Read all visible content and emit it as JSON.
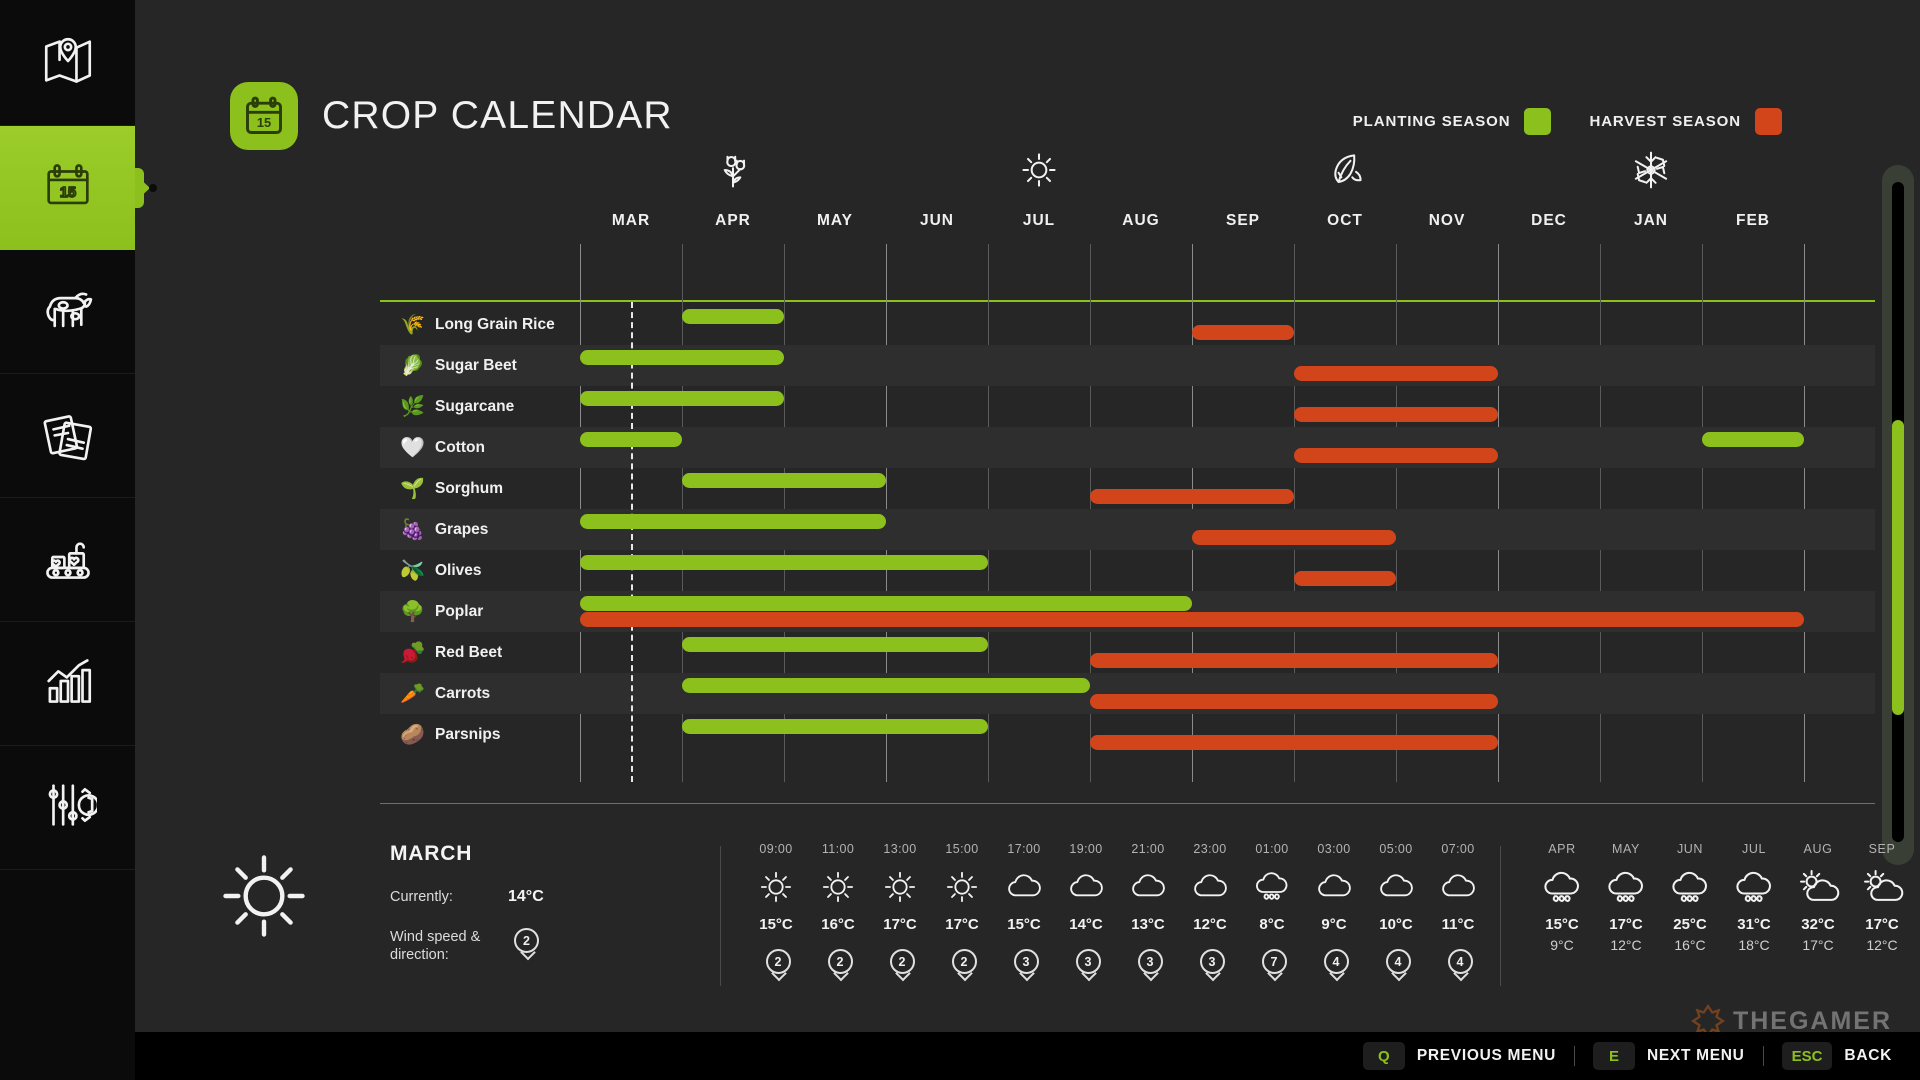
{
  "header": {
    "title": "CROP CALENDAR",
    "calendar_icon_day": "15"
  },
  "legend": {
    "planting_label": "PLANTING SEASON",
    "planting_color": "#8cc01c",
    "harvest_label": "HARVEST SEASON",
    "harvest_color": "#d2451b"
  },
  "sidebar": {
    "items": [
      {
        "name": "map",
        "icon": "map-icon",
        "active": false
      },
      {
        "name": "calendar",
        "icon": "calendar-icon",
        "active": true
      },
      {
        "name": "animals",
        "icon": "cow-icon",
        "active": false
      },
      {
        "name": "contracts",
        "icon": "documents-icon",
        "active": false
      },
      {
        "name": "production",
        "icon": "conveyor-icon",
        "active": false
      },
      {
        "name": "statistics",
        "icon": "bar-chart-icon",
        "active": false
      },
      {
        "name": "settings",
        "icon": "sliders-gear-icon",
        "active": false
      }
    ]
  },
  "chart_data": {
    "type": "table",
    "title": "CROP CALENDAR",
    "months": [
      "MAR",
      "APR",
      "MAY",
      "JUN",
      "JUL",
      "AUG",
      "SEP",
      "OCT",
      "NOV",
      "DEC",
      "JAN",
      "FEB"
    ],
    "season_markers": [
      {
        "month": "APR",
        "icon": "flower-icon",
        "season": "spring"
      },
      {
        "month": "JUL",
        "icon": "sun-icon",
        "season": "summer"
      },
      {
        "month": "OCT",
        "icon": "leaf-icon",
        "season": "autumn"
      },
      {
        "month": "JAN",
        "icon": "snowflake-icon",
        "season": "winter"
      }
    ],
    "current_month_marker": "MAR",
    "rows": [
      {
        "crop": "Long Grain Rice",
        "icon": "🌾",
        "planting": [
          {
            "start": 1,
            "end": 2
          }
        ],
        "harvest": [
          {
            "start": 6,
            "end": 7
          }
        ]
      },
      {
        "crop": "Sugar Beet",
        "icon": "🥬",
        "planting": [
          {
            "start": 0,
            "end": 2
          }
        ],
        "harvest": [
          {
            "start": 7,
            "end": 9
          }
        ]
      },
      {
        "crop": "Sugarcane",
        "icon": "🌿",
        "planting": [
          {
            "start": 0,
            "end": 2
          }
        ],
        "harvest": [
          {
            "start": 7,
            "end": 9
          }
        ]
      },
      {
        "crop": "Cotton",
        "icon": "🤍",
        "planting": [
          {
            "start": 0,
            "end": 1
          },
          {
            "start": 11,
            "end": 12
          }
        ],
        "harvest": [
          {
            "start": 7,
            "end": 9
          }
        ]
      },
      {
        "crop": "Sorghum",
        "icon": "🌱",
        "planting": [
          {
            "start": 1,
            "end": 3
          }
        ],
        "harvest": [
          {
            "start": 5,
            "end": 7
          }
        ]
      },
      {
        "crop": "Grapes",
        "icon": "🍇",
        "planting": [
          {
            "start": 0,
            "end": 3
          }
        ],
        "harvest": [
          {
            "start": 6,
            "end": 8
          }
        ]
      },
      {
        "crop": "Olives",
        "icon": "🫒",
        "planting": [
          {
            "start": 0,
            "end": 4
          }
        ],
        "harvest": [
          {
            "start": 7,
            "end": 8
          }
        ]
      },
      {
        "crop": "Poplar",
        "icon": "🌳",
        "planting": [
          {
            "start": 0,
            "end": 6
          }
        ],
        "harvest": [
          {
            "start": 0,
            "end": 12
          }
        ]
      },
      {
        "crop": "Red Beet",
        "icon": "🫜",
        "planting": [
          {
            "start": 1,
            "end": 4
          }
        ],
        "harvest": [
          {
            "start": 5,
            "end": 9
          }
        ]
      },
      {
        "crop": "Carrots",
        "icon": "🥕",
        "planting": [
          {
            "start": 1,
            "end": 5
          }
        ],
        "harvest": [
          {
            "start": 5,
            "end": 9
          }
        ]
      },
      {
        "crop": "Parsnips",
        "icon": "🥔",
        "planting": [
          {
            "start": 1,
            "end": 4
          }
        ],
        "harvest": [
          {
            "start": 5,
            "end": 9
          }
        ]
      }
    ]
  },
  "weather": {
    "current_icon": "sun-icon",
    "month": "MARCH",
    "currently_label": "Currently:",
    "currently_value": "14°C",
    "wind_label": "Wind speed &\ndirection:",
    "wind_value": "2",
    "hourly": [
      {
        "time": "09:00",
        "icon": "sun-icon",
        "temp": "15°C",
        "wind": "2"
      },
      {
        "time": "11:00",
        "icon": "sun-icon",
        "temp": "16°C",
        "wind": "2"
      },
      {
        "time": "13:00",
        "icon": "sun-icon",
        "temp": "17°C",
        "wind": "2"
      },
      {
        "time": "15:00",
        "icon": "sun-icon",
        "temp": "17°C",
        "wind": "2"
      },
      {
        "time": "17:00",
        "icon": "cloud-icon",
        "temp": "15°C",
        "wind": "3"
      },
      {
        "time": "19:00",
        "icon": "cloud-icon",
        "temp": "14°C",
        "wind": "3"
      },
      {
        "time": "21:00",
        "icon": "cloud-icon",
        "temp": "13°C",
        "wind": "3"
      },
      {
        "time": "23:00",
        "icon": "cloud-icon",
        "temp": "12°C",
        "wind": "3"
      },
      {
        "time": "01:00",
        "icon": "rain-icon",
        "temp": "8°C",
        "wind": "7"
      },
      {
        "time": "03:00",
        "icon": "cloud-icon",
        "temp": "9°C",
        "wind": "4"
      },
      {
        "time": "05:00",
        "icon": "cloud-icon",
        "temp": "10°C",
        "wind": "4"
      },
      {
        "time": "07:00",
        "icon": "cloud-icon",
        "temp": "11°C",
        "wind": "4"
      }
    ],
    "monthly": [
      {
        "month": "APR",
        "icon": "rain-icon",
        "high": "15°C",
        "low": "9°C"
      },
      {
        "month": "MAY",
        "icon": "rain-icon",
        "high": "17°C",
        "low": "12°C"
      },
      {
        "month": "JUN",
        "icon": "rain-icon",
        "high": "25°C",
        "low": "16°C"
      },
      {
        "month": "JUL",
        "icon": "rain-icon",
        "high": "31°C",
        "low": "18°C"
      },
      {
        "month": "AUG",
        "icon": "partly-sunny-icon",
        "high": "32°C",
        "low": "17°C"
      },
      {
        "month": "SEP",
        "icon": "partly-sunny-icon",
        "high": "17°C",
        "low": "12°C"
      }
    ]
  },
  "footer": {
    "actions": [
      {
        "key": "Q",
        "label": "PREVIOUS MENU"
      },
      {
        "key": "E",
        "label": "NEXT MENU"
      },
      {
        "key": "ESC",
        "label": "BACK"
      }
    ],
    "watermark": "THEGAMER"
  }
}
